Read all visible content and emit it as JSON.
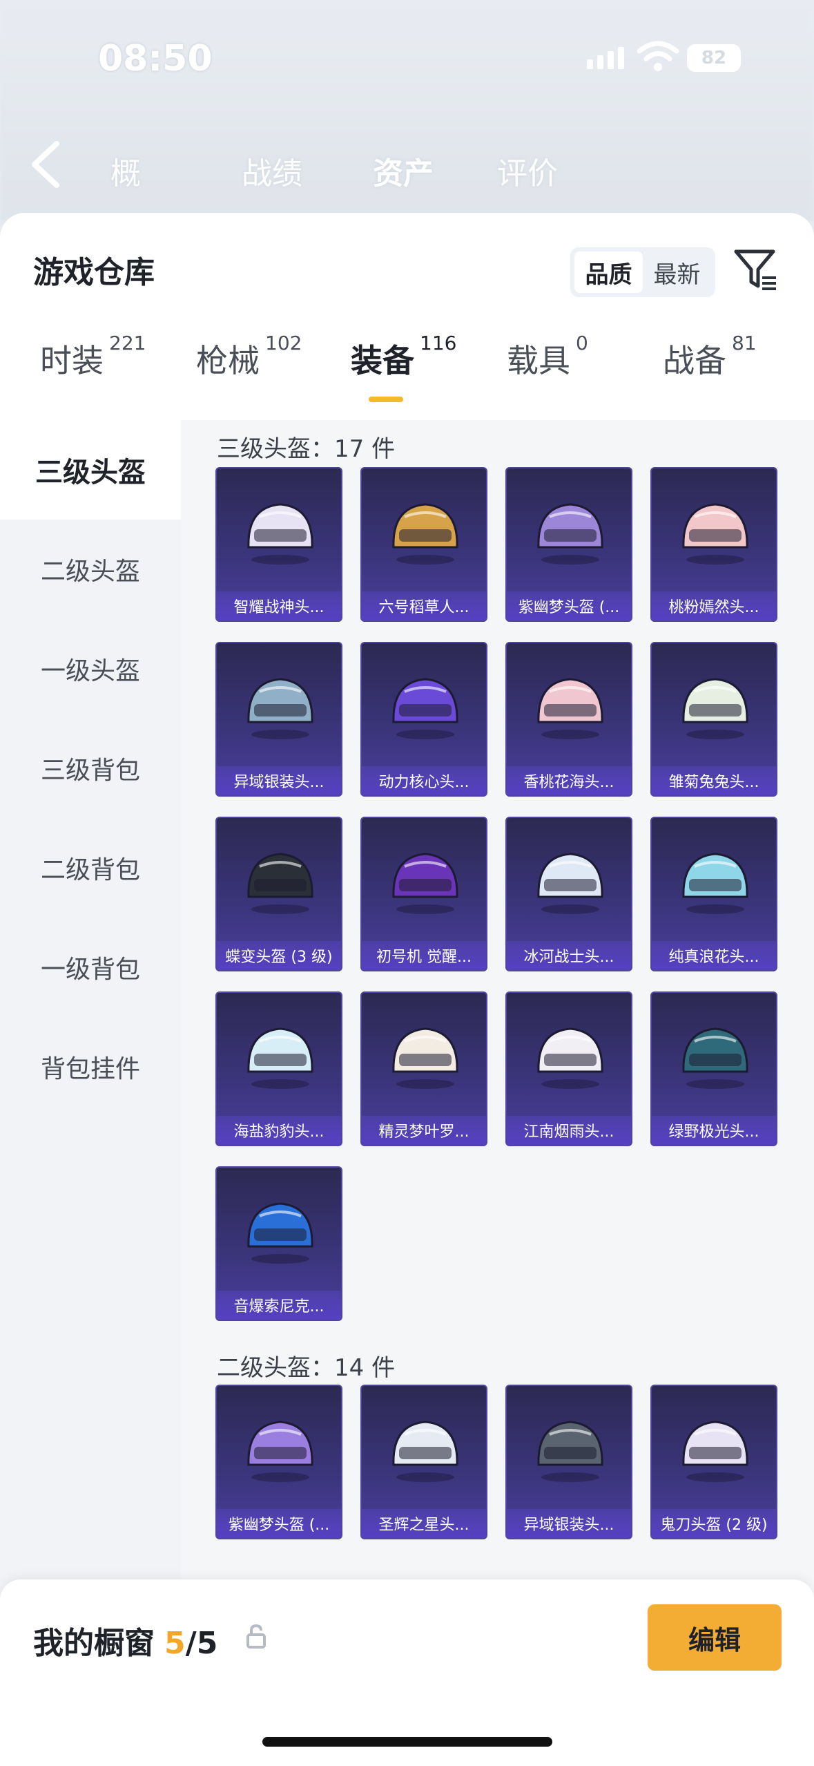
{
  "status_bar": {
    "time": "08:50",
    "battery": "82"
  },
  "background_nav": {
    "tabs": [
      {
        "label": "概"
      },
      {
        "label": "战绩"
      },
      {
        "label": "资产"
      },
      {
        "label": "评价"
      }
    ]
  },
  "sheet": {
    "title": "游戏仓库",
    "sort_options": [
      {
        "label": "品质"
      },
      {
        "label": "最新"
      }
    ],
    "categories": [
      {
        "label": "时装",
        "count": "221"
      },
      {
        "label": "枪械",
        "count": "102"
      },
      {
        "label": "装备",
        "count": "116"
      },
      {
        "label": "载具",
        "count": "0"
      },
      {
        "label": "战备",
        "count": "81"
      }
    ],
    "sidebar": [
      {
        "label": "三级头盔"
      },
      {
        "label": "二级头盔"
      },
      {
        "label": "一级头盔"
      },
      {
        "label": "三级背包"
      },
      {
        "label": "二级背包"
      },
      {
        "label": "一级背包"
      },
      {
        "label": "背包挂件"
      }
    ],
    "groups": [
      {
        "title": "三级头盔：17 件",
        "items": [
          {
            "name": "智耀战神头..."
          },
          {
            "name": "六号稻草人..."
          },
          {
            "name": "紫幽梦头盔 (..."
          },
          {
            "name": "桃粉嫣然头..."
          },
          {
            "name": "异域银装头..."
          },
          {
            "name": "动力核心头..."
          },
          {
            "name": "香桃花海头..."
          },
          {
            "name": "雏菊兔兔头..."
          },
          {
            "name": "蝶变头盔 (3 级)"
          },
          {
            "name": "初号机 觉醒..."
          },
          {
            "name": "冰河战士头..."
          },
          {
            "name": "纯真浪花头..."
          },
          {
            "name": "海盐豹豹头..."
          },
          {
            "name": "精灵梦叶罗..."
          },
          {
            "name": "江南烟雨头..."
          },
          {
            "name": "绿野极光头..."
          },
          {
            "name": "音爆索尼克..."
          }
        ]
      },
      {
        "title": "二级头盔：14 件",
        "items": [
          {
            "name": "紫幽梦头盔 (..."
          },
          {
            "name": "圣辉之星头..."
          },
          {
            "name": "异域银装头..."
          },
          {
            "name": "鬼刀头盔 (2 级)"
          }
        ]
      }
    ]
  },
  "showcase": {
    "title": "我的橱窗",
    "current": "5",
    "separator": "/",
    "total": "5",
    "edit_label": "编辑"
  },
  "colors": {
    "accent": "#f3ad35",
    "card_bg": "#3a3479",
    "card_label": "#5640c2"
  }
}
